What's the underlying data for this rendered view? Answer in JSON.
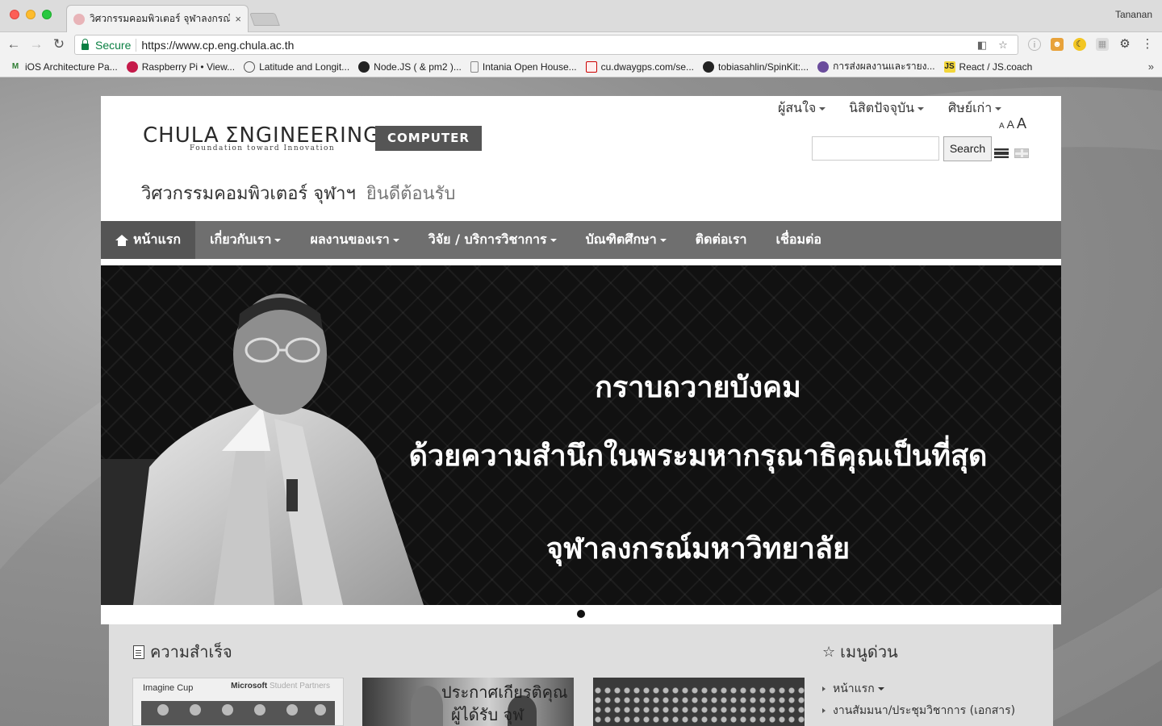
{
  "browser": {
    "tab_title": "วิศวกรรมคอมพิวเตอร์ จุฬาลงกรณ์...",
    "tab_close": "×",
    "profile_name": "Tananan",
    "secure_label": "Secure",
    "url": "https://www.cp.eng.chula.ac.th",
    "bookmarks": [
      {
        "label": "iOS Architecture Pa...",
        "icon": "m-icon"
      },
      {
        "label": "Raspberry Pi • View...",
        "icon": "raspberry-icon"
      },
      {
        "label": "Latitude and Longit...",
        "icon": "compass-icon"
      },
      {
        "label": "Node.JS ( & pm2 )...",
        "icon": "github-icon"
      },
      {
        "label": "Intania Open House...",
        "icon": "page-icon"
      },
      {
        "label": "cu.dwaygps.com/se...",
        "icon": "image-icon"
      },
      {
        "label": "tobiasahlin/SpinKit:...",
        "icon": "github-icon"
      },
      {
        "label": "การส่งผลงานและรายง...",
        "icon": "badge-icon"
      },
      {
        "label": "React / JS.coach",
        "icon": "js-icon"
      }
    ],
    "bookmarks_more": "»"
  },
  "header": {
    "logo_chula": "CHULA",
    "logo_engineering": "ΣNGINEERING",
    "logo_tagline": "Foundation toward Innovation",
    "logo_badge": "COMPUTER",
    "site_title": "วิศวกรรมคอมพิวเตอร์ จุฬาฯ",
    "site_welcome": "ยินดีต้อนรับ",
    "top_links": [
      "ผู้สนใจ",
      "นิสิตปัจจุบัน",
      "ศิษย์เก่า"
    ],
    "font_sizes": [
      "A",
      "A",
      "A"
    ],
    "search_button": "Search"
  },
  "mainnav": {
    "items": [
      {
        "label": "หน้าแรก",
        "dropdown": false
      },
      {
        "label": "เกี่ยวกับเรา",
        "dropdown": true
      },
      {
        "label": "ผลงานของเรา",
        "dropdown": true
      },
      {
        "label": "วิจัย / บริการวิชาการ",
        "dropdown": true
      },
      {
        "label": "บัณฑิตศึกษา",
        "dropdown": true
      },
      {
        "label": "ติดต่อเรา",
        "dropdown": false
      },
      {
        "label": "เชื่อมต่อ",
        "dropdown": false
      }
    ]
  },
  "banner": {
    "line1": "กราบถวายบังคม",
    "line2": "ด้วยความสำนึกในพระมหากรุณาธิคุณเป็นที่สุด",
    "line3": "จุฬาลงกรณ์มหาวิทยาลัย"
  },
  "content": {
    "section_title": "ความสำเร็จ",
    "thumb1_brand": "Imagine Cup",
    "thumb1_brand2": "Microsoft",
    "thumb1_brand2b": " Student Partners",
    "thumb2_text1": "ประกาศเกียรติคุณ",
    "thumb2_text2": "ผู้ได้รับ   จุฬ",
    "quickmenu_title": "เมนูด่วน",
    "quickmenu_items": [
      {
        "label": "หน้าแรก",
        "dropdown": true
      },
      {
        "label": "งานสัมมนา/ประชุมวิชาการ (เอกสาร)",
        "dropdown": false
      }
    ]
  }
}
